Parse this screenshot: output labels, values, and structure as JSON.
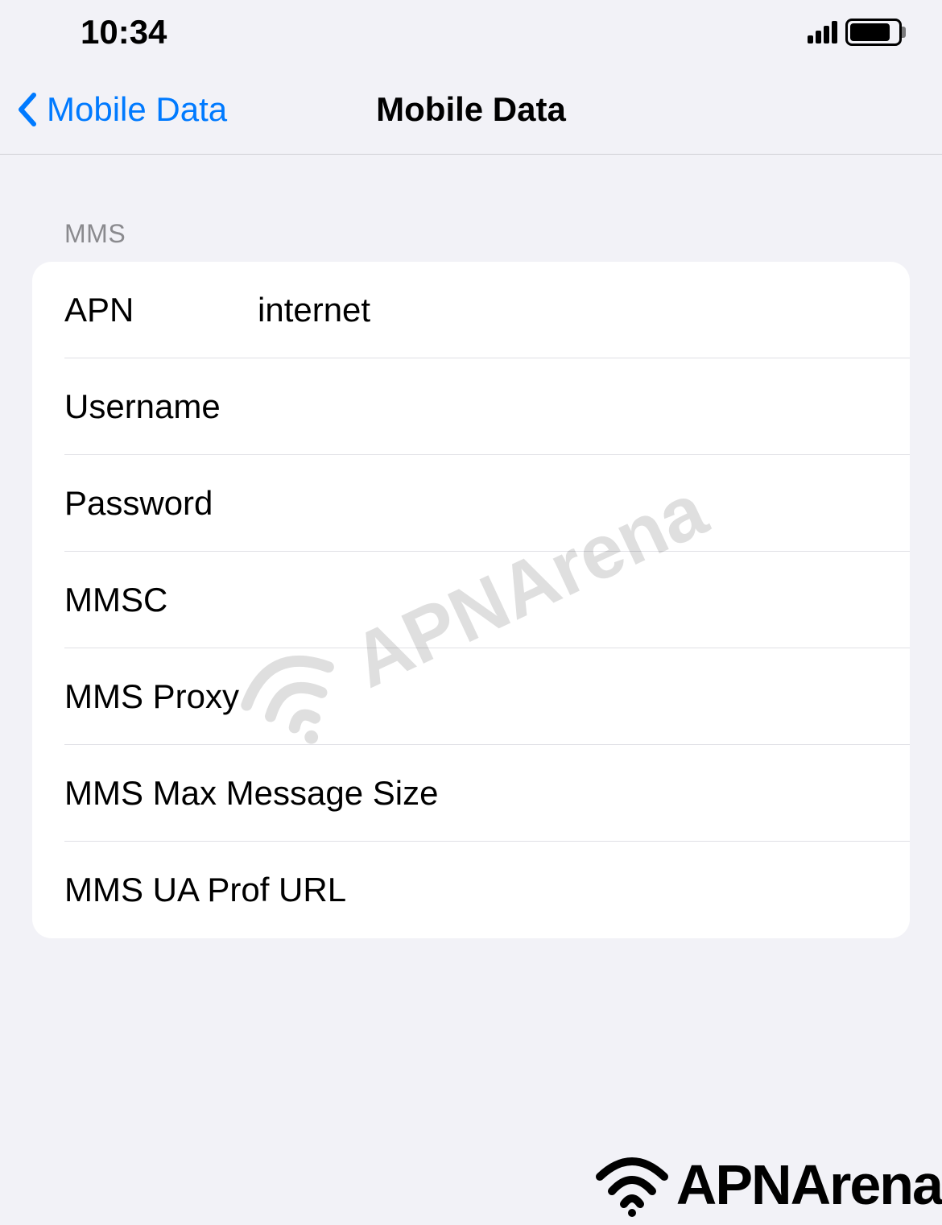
{
  "status_bar": {
    "time": "10:34"
  },
  "nav": {
    "back_label": "Mobile Data",
    "title": "Mobile Data"
  },
  "section": {
    "header": "MMS",
    "rows": [
      {
        "label": "APN",
        "value": "internet"
      },
      {
        "label": "Username",
        "value": ""
      },
      {
        "label": "Password",
        "value": ""
      },
      {
        "label": "MMSC",
        "value": ""
      },
      {
        "label": "MMS Proxy",
        "value": ""
      },
      {
        "label": "MMS Max Message Size",
        "value": ""
      },
      {
        "label": "MMS UA Prof URL",
        "value": ""
      }
    ]
  },
  "watermark": {
    "text": "APNArena"
  }
}
